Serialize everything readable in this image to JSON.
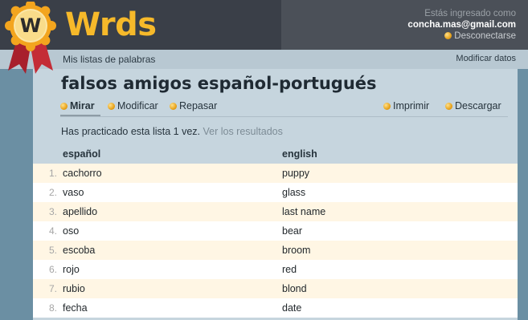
{
  "brand": {
    "logo_letter": "W",
    "name": "Wrds"
  },
  "account": {
    "status": "Estás ingresado como",
    "email": "concha.mas@gmail.com",
    "logout": "Desconectarse"
  },
  "subnav": {
    "my_lists": "Mis listas de palabras",
    "edit_profile": "Modificar datos"
  },
  "list": {
    "title": "falsos amigos español-portugués",
    "tabs": [
      {
        "label": "Mirar",
        "active": true
      },
      {
        "label": "Modificar",
        "active": false
      },
      {
        "label": "Repasar",
        "active": false
      }
    ],
    "actions": [
      {
        "label": "Imprimir"
      },
      {
        "label": "Descargar"
      }
    ],
    "practice_text": "Has practicado esta lista 1 vez.",
    "practice_link": "Ver los resultados",
    "columns": [
      "español",
      "english"
    ],
    "rows": [
      {
        "n": "1.",
        "es": "cachorro",
        "en": "puppy"
      },
      {
        "n": "2.",
        "es": "vaso",
        "en": "glass"
      },
      {
        "n": "3.",
        "es": "apellido",
        "en": "last name"
      },
      {
        "n": "4.",
        "es": "oso",
        "en": "bear"
      },
      {
        "n": "5.",
        "es": "escoba",
        "en": "broom"
      },
      {
        "n": "6.",
        "es": "rojo",
        "en": "red"
      },
      {
        "n": "7.",
        "es": "rubio",
        "en": "blond"
      },
      {
        "n": "8.",
        "es": "fecha",
        "en": "date"
      }
    ]
  },
  "colors": {
    "brand": "#f6b92a",
    "header_bg": "#3a3f48",
    "panel_bg": "#c6d5de",
    "row_alt": "#fff6e4",
    "bullet": "#e8a31c"
  },
  "icons": [
    "seal-logo-icon",
    "bullet-dot-icon"
  ]
}
